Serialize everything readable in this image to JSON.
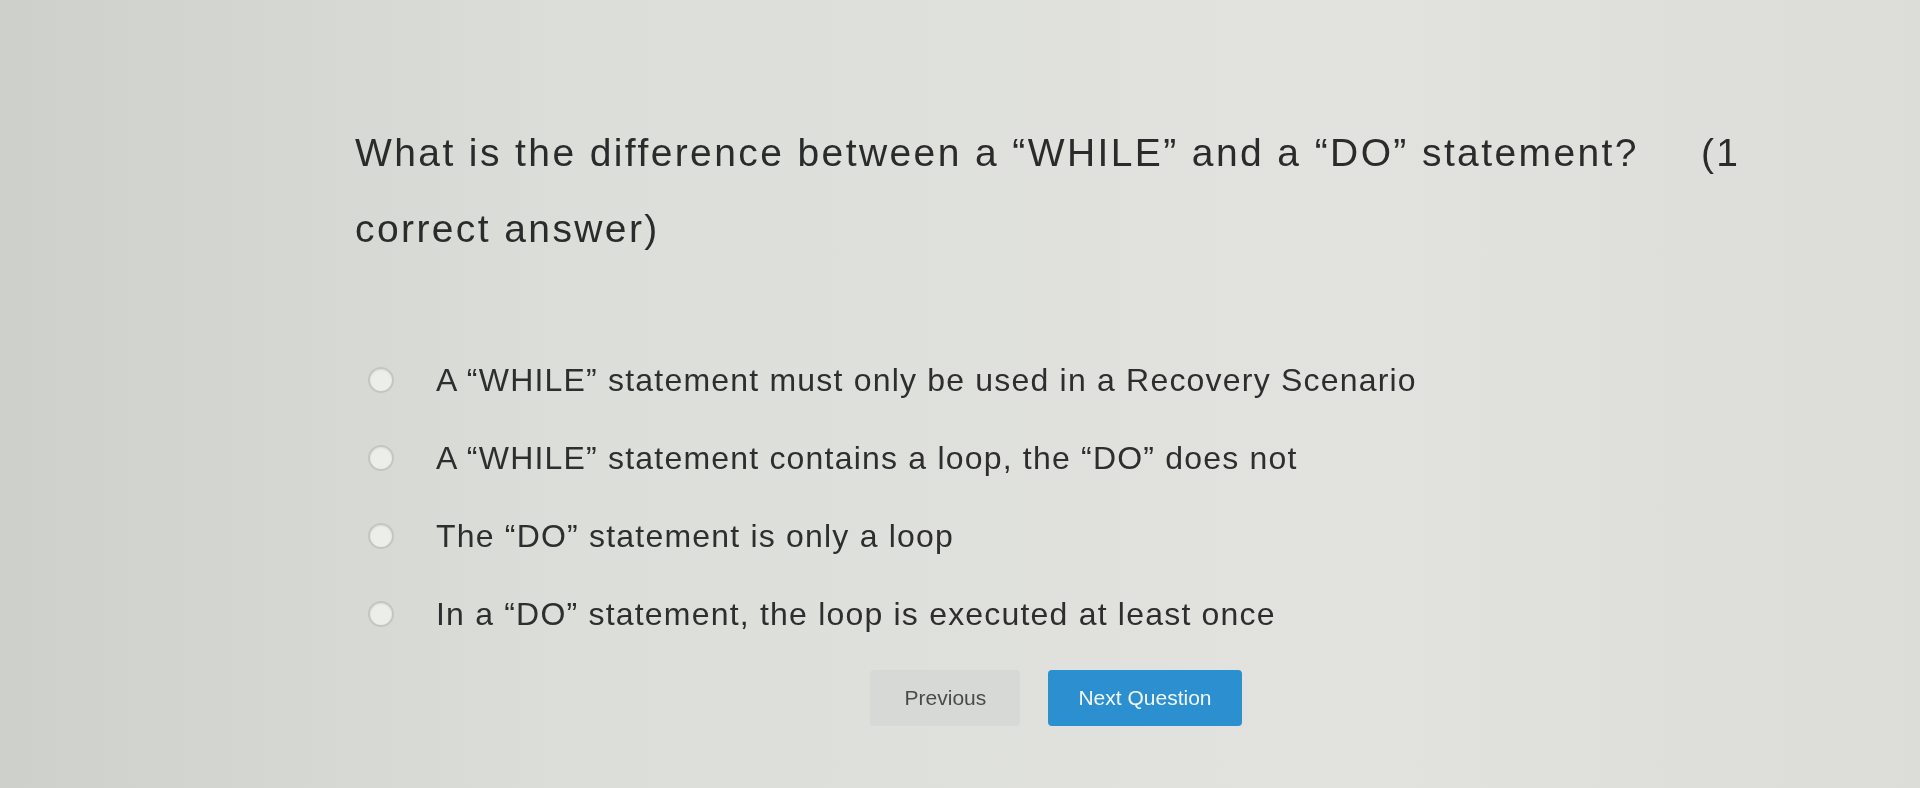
{
  "question": {
    "text": "What is the difference between a “WHILE” and a “DO” statement?",
    "hint": "(1 correct answer)"
  },
  "options": [
    {
      "label": "A “WHILE” statement must only be used in a Recovery Scenario",
      "selected": false
    },
    {
      "label": "A “WHILE” statement contains a loop, the “DO” does not",
      "selected": false
    },
    {
      "label": "The “DO” statement is only a loop",
      "selected": false
    },
    {
      "label": "In a “DO” statement, the loop is executed at least once",
      "selected": false
    }
  ],
  "buttons": [
    {
      "label": "Previous",
      "kind": "secondary"
    },
    {
      "label": "Next Question",
      "kind": "primary"
    }
  ]
}
